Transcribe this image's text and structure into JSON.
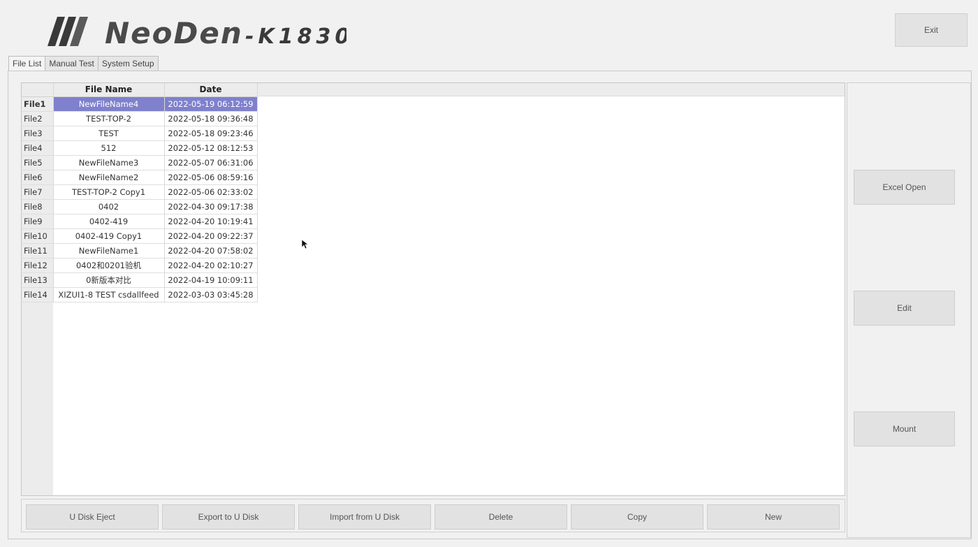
{
  "app": {
    "logo_brand": "NeoDen",
    "logo_model": "-K1830",
    "exit_label": "Exit"
  },
  "tabs": [
    {
      "label": "File List",
      "active": true
    },
    {
      "label": "Manual Test",
      "active": false
    },
    {
      "label": "System Setup",
      "active": false
    }
  ],
  "table": {
    "columns": [
      "File Name",
      "Date"
    ],
    "selected_row": "File1",
    "rows": [
      {
        "id": "File1",
        "name": "NewFileName4",
        "date": "2022-05-19 06:12:59"
      },
      {
        "id": "File2",
        "name": "TEST-TOP-2",
        "date": "2022-05-18 09:36:48"
      },
      {
        "id": "File3",
        "name": "TEST",
        "date": "2022-05-18 09:23:46"
      },
      {
        "id": "File4",
        "name": "512",
        "date": "2022-05-12 08:12:53"
      },
      {
        "id": "File5",
        "name": "NewFileName3",
        "date": "2022-05-07 06:31:06"
      },
      {
        "id": "File6",
        "name": "NewFileName2",
        "date": "2022-05-06 08:59:16"
      },
      {
        "id": "File7",
        "name": "TEST-TOP-2 Copy1",
        "date": "2022-05-06 02:33:02"
      },
      {
        "id": "File8",
        "name": "0402",
        "date": "2022-04-30 09:17:38"
      },
      {
        "id": "File9",
        "name": "0402-419",
        "date": "2022-04-20 10:19:41"
      },
      {
        "id": "File10",
        "name": "0402-419 Copy1",
        "date": "2022-04-20 09:22:37"
      },
      {
        "id": "File11",
        "name": "NewFileName1",
        "date": "2022-04-20 07:58:02"
      },
      {
        "id": "File12",
        "name": "0402和0201验机",
        "date": "2022-04-20 02:10:27"
      },
      {
        "id": "File13",
        "name": "0新版本对比",
        "date": "2022-04-19 10:09:11"
      },
      {
        "id": "File14",
        "name": "XIZUI1-8 TEST  csdallfeed",
        "date": "2022-03-03 03:45:28"
      }
    ]
  },
  "side_buttons": {
    "excel_open": "Excel Open",
    "edit": "Edit",
    "mount": "Mount"
  },
  "bottom_buttons": {
    "u_disk_eject": "U Disk Eject",
    "export_to_u_disk": "Export to U Disk",
    "import_from_u_disk": "Import from U Disk",
    "delete": "Delete",
    "copy": "Copy",
    "new": "New"
  },
  "colors": {
    "selection": "#7f81cd",
    "button": "#e2e2e2",
    "background": "#f1f1f1"
  }
}
